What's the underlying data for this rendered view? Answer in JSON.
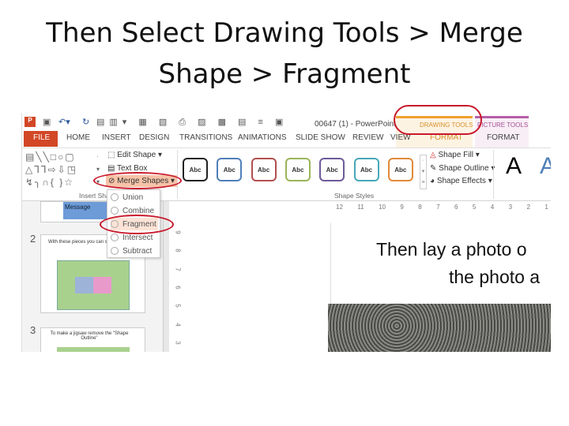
{
  "slide": {
    "title_line1": "Then Select Drawing Tools > Merge",
    "title_line2": "Shape > Fragment"
  },
  "window": {
    "title": "00647 (1) - PowerPoint",
    "app_icon": "powerpoint-icon"
  },
  "tabs": [
    "FILE",
    "HOME",
    "INSERT",
    "DESIGN",
    "TRANSITIONS",
    "ANIMATIONS",
    "SLIDE SHOW",
    "REVIEW",
    "VIEW",
    "FORMAT",
    "FORMAT"
  ],
  "contextual": {
    "drawing_tools": "DRAWING TOOLS",
    "picture_tools": "PICTURE TOOLS",
    "drawing_color": "#f0a030",
    "picture_color": "#b560a8"
  },
  "ribbon": {
    "edit_shape": "Edit Shape",
    "text_box": "Text Box",
    "merge_shapes": "Merge Shapes",
    "insert_shapes_group": "Insert Sha",
    "shape_styles_group": "Shape Styles",
    "style_label": "Abc",
    "style_colors": [
      "#222222",
      "#4f7fb8",
      "#b25050",
      "#9bb55a",
      "#6e5a9a",
      "#47a8b8",
      "#e08a3a"
    ],
    "shape_fill": "Shape Fill",
    "shape_outline": "Shape Outline",
    "shape_effects": "Shape Effects",
    "wordart": "A"
  },
  "merge_menu": [
    "Union",
    "Combine",
    "Fragment",
    "Intersect",
    "Subtract"
  ],
  "ruler": [
    "12",
    "11",
    "10",
    "9",
    "8",
    "7",
    "6",
    "5",
    "4",
    "3",
    "2",
    "1"
  ],
  "vruler": [
    "9",
    "8",
    "7",
    "6",
    "5",
    "4",
    "3"
  ],
  "thumbnails": [
    {
      "num": "",
      "text": "Message"
    },
    {
      "num": "2",
      "text": "With these pieces you can sized jigsaw"
    },
    {
      "num": "3",
      "text": "To make a jigsaw remove the \"Shape Outline\""
    }
  ],
  "canvas": {
    "line1": "Then lay a photo o",
    "line2": "the photo a"
  },
  "annotation_color": "#c8182b"
}
